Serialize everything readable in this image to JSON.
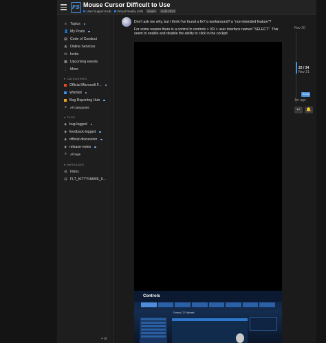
{
  "header": {
    "title": "Mouse Cursor Difficult to Use",
    "logo_text": "FS",
    "breadcrumbs": [
      {
        "label": "User Support Hub",
        "color": "#1a73e8"
      },
      {
        "label": "Virtual Reality (VR)",
        "color": "#1e88e5"
      }
    ],
    "tags": [
      "steam",
      "msfs-2024"
    ]
  },
  "sidebar": {
    "nav": [
      "Topics",
      "My Posts",
      "Code of Conduct",
      "Online Services",
      "Invite",
      "Upcoming events",
      "More"
    ],
    "categories_heading": "CATEGORIES",
    "categories": [
      {
        "label": "Official Microsoft F...",
        "color": "#e64a19"
      },
      {
        "label": "Wishlist",
        "color": "#3c8df0"
      },
      {
        "label": "Bug Reporting Hub",
        "color": "#f0a020"
      },
      {
        "label": "All categories",
        "color": ""
      }
    ],
    "tags_heading": "TAGS",
    "tags": [
      "bug-logged",
      "feedback-logged",
      "official-discussion",
      "release-notes",
      "All tags"
    ],
    "messages_heading": "MESSAGES",
    "messages": [
      "Inbox",
      "FLT_KITTYHAWK_6..."
    ],
    "footer_glyph": "+ ⊟"
  },
  "post": {
    "paragraphs": [
      "Don’t ask me why, but I think I’ve found a fix? a workaround? a “non-intended feature”?",
      "For some reason there is a control in controls > VR > user interface named “SELECT”. This seem to enable and disable the ability to click in the cockpit"
    ],
    "thumb": {
      "title": "Controls",
      "device": "Cessna 172 Skyhawk"
    }
  },
  "timeline": {
    "start_date": "Nov 20",
    "position": "22 / 34",
    "position_date": "Nov 21",
    "reply_label": "Reply",
    "end_label": "1m ago",
    "reply_icon": "reply-icon",
    "notify_icon": "bell-icon",
    "accent": "#4a90d9",
    "progress": 0.647
  }
}
